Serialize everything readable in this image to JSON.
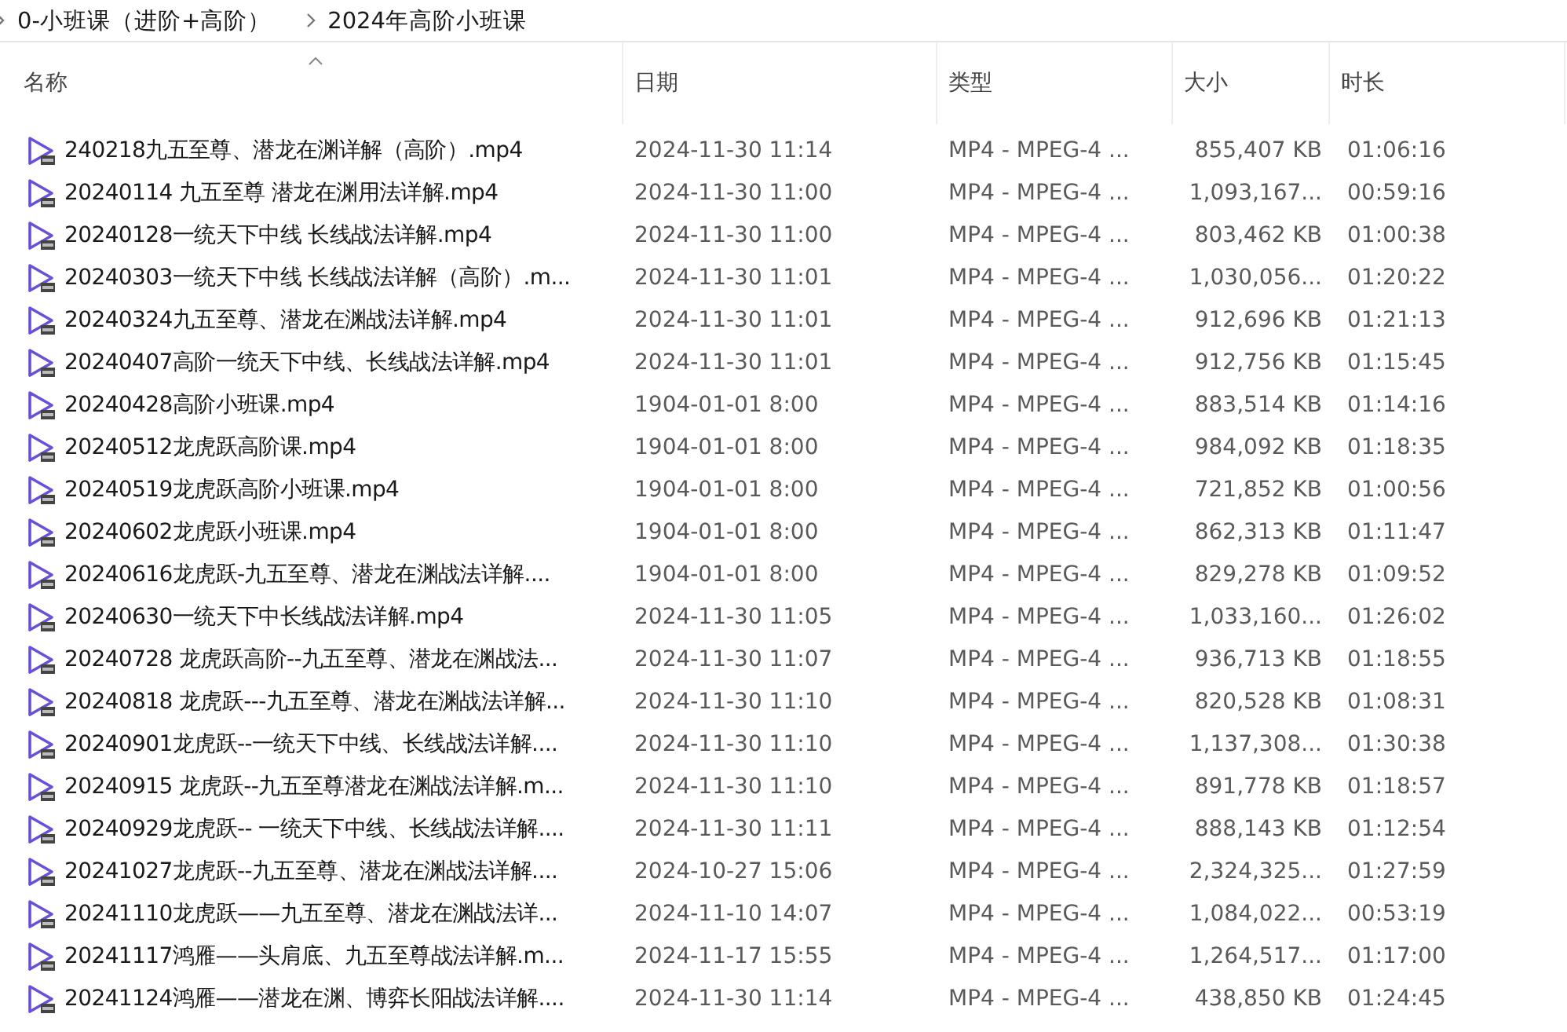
{
  "breadcrumb": [
    "0-小班课（进阶+高阶）",
    "2024年高阶小班课"
  ],
  "columns": [
    {
      "label": "名称",
      "sorted": true
    },
    {
      "label": "日期",
      "sorted": false
    },
    {
      "label": "类型",
      "sorted": false
    },
    {
      "label": "大小",
      "sorted": false
    },
    {
      "label": "时长",
      "sorted": false
    }
  ],
  "rows": [
    {
      "name": "240218九五至尊、潜龙在渊详解（高阶）.mp4",
      "date": "2024-11-30 11:14",
      "type": "MP4 - MPEG-4 ...",
      "size": "855,407 KB",
      "duration": "01:06:16"
    },
    {
      "name": "20240114 九五至尊 潜龙在渊用法详解.mp4",
      "date": "2024-11-30 11:00",
      "type": "MP4 - MPEG-4 ...",
      "size": "1,093,167...",
      "duration": "00:59:16"
    },
    {
      "name": "20240128一统天下中线 长线战法详解.mp4",
      "date": "2024-11-30 11:00",
      "type": "MP4 - MPEG-4 ...",
      "size": "803,462 KB",
      "duration": "01:00:38"
    },
    {
      "name": "20240303一统天下中线 长线战法详解（高阶）.m...",
      "date": "2024-11-30 11:01",
      "type": "MP4 - MPEG-4 ...",
      "size": "1,030,056...",
      "duration": "01:20:22"
    },
    {
      "name": "20240324九五至尊、潜龙在渊战法详解.mp4",
      "date": "2024-11-30 11:01",
      "type": "MP4 - MPEG-4 ...",
      "size": "912,696 KB",
      "duration": "01:21:13"
    },
    {
      "name": "20240407高阶一统天下中线、长线战法详解.mp4",
      "date": "2024-11-30 11:01",
      "type": "MP4 - MPEG-4 ...",
      "size": "912,756 KB",
      "duration": "01:15:45"
    },
    {
      "name": "20240428高阶小班课.mp4",
      "date": "1904-01-01 8:00",
      "type": "MP4 - MPEG-4 ...",
      "size": "883,514 KB",
      "duration": "01:14:16"
    },
    {
      "name": "20240512龙虎跃高阶课.mp4",
      "date": "1904-01-01 8:00",
      "type": "MP4 - MPEG-4 ...",
      "size": "984,092 KB",
      "duration": "01:18:35"
    },
    {
      "name": "20240519龙虎跃高阶小班课.mp4",
      "date": "1904-01-01 8:00",
      "type": "MP4 - MPEG-4 ...",
      "size": "721,852 KB",
      "duration": "01:00:56"
    },
    {
      "name": "20240602龙虎跃小班课.mp4",
      "date": "1904-01-01 8:00",
      "type": "MP4 - MPEG-4 ...",
      "size": "862,313 KB",
      "duration": "01:11:47"
    },
    {
      "name": "20240616龙虎跃-九五至尊、潜龙在渊战法详解....",
      "date": "1904-01-01 8:00",
      "type": "MP4 - MPEG-4 ...",
      "size": "829,278 KB",
      "duration": "01:09:52"
    },
    {
      "name": "20240630一统天下中长线战法详解.mp4",
      "date": "2024-11-30 11:05",
      "type": "MP4 - MPEG-4 ...",
      "size": "1,033,160...",
      "duration": "01:26:02"
    },
    {
      "name": "20240728 龙虎跃高阶--九五至尊、潜龙在渊战法...",
      "date": "2024-11-30 11:07",
      "type": "MP4 - MPEG-4 ...",
      "size": "936,713 KB",
      "duration": "01:18:55"
    },
    {
      "name": "20240818 龙虎跃---九五至尊、潜龙在渊战法详解...",
      "date": "2024-11-30 11:10",
      "type": "MP4 - MPEG-4 ...",
      "size": "820,528 KB",
      "duration": "01:08:31"
    },
    {
      "name": "20240901龙虎跃--一统天下中线、长线战法详解....",
      "date": "2024-11-30 11:10",
      "type": "MP4 - MPEG-4 ...",
      "size": "1,137,308...",
      "duration": "01:30:38"
    },
    {
      "name": "20240915 龙虎跃--九五至尊潜龙在渊战法详解.m...",
      "date": "2024-11-30 11:10",
      "type": "MP4 - MPEG-4 ...",
      "size": "891,778 KB",
      "duration": "01:18:57"
    },
    {
      "name": "20240929龙虎跃-- 一统天下中线、长线战法详解....",
      "date": "2024-11-30 11:11",
      "type": "MP4 - MPEG-4 ...",
      "size": "888,143 KB",
      "duration": "01:12:54"
    },
    {
      "name": "20241027龙虎跃--九五至尊、潜龙在渊战法详解....",
      "date": "2024-10-27 15:06",
      "type": "MP4 - MPEG-4 ...",
      "size": "2,324,325...",
      "duration": "01:27:59"
    },
    {
      "name": "20241110龙虎跃——九五至尊、潜龙在渊战法详...",
      "date": "2024-11-10 14:07",
      "type": "MP4 - MPEG-4 ...",
      "size": "1,084,022...",
      "duration": "00:53:19"
    },
    {
      "name": "20241117鸿雁——头肩底、九五至尊战法详解.m...",
      "date": "2024-11-17 15:55",
      "type": "MP4 - MPEG-4 ...",
      "size": "1,264,517...",
      "duration": "01:17:00"
    },
    {
      "name": "20241124鸿雁——潜龙在渊、博弈长阳战法详解....",
      "date": "2024-11-30 11:14",
      "type": "MP4 - MPEG-4 ...",
      "size": "438,850 KB",
      "duration": "01:24:45"
    }
  ]
}
